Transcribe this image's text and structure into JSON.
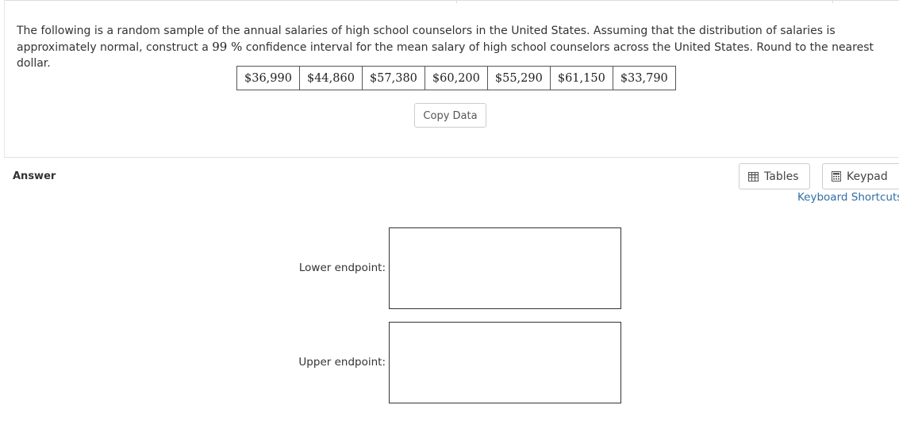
{
  "question": {
    "text_before": "The following is a random sample of the annual salaries of high school counselors in the United States. Assuming that the distribution of salaries is approximately normal, construct a ",
    "confidence_value": "99 %",
    "text_after": " confidence interval for the mean salary of high school counselors across the United States. Round to the nearest dollar."
  },
  "data_table": {
    "values": [
      "$36,990",
      "$44,860",
      "$57,380",
      "$60,200",
      "$55,290",
      "$61,150",
      "$33,790"
    ]
  },
  "copy_data_label": "Copy Data",
  "answer": {
    "label": "Answer",
    "tables_label": "Tables",
    "tables_icon": "table-grid-icon",
    "keypad_label": "Keypad",
    "keypad_icon": "calculator-icon",
    "keyboard_shortcuts_label": "Keyboard Shortcuts",
    "lower_endpoint_label": "Lower endpoint:",
    "lower_endpoint_value": "",
    "upper_endpoint_label": "Upper endpoint:",
    "upper_endpoint_value": ""
  },
  "colors": {
    "link": "#2f6ea6",
    "text": "#333333",
    "border": "#c8ced4"
  }
}
